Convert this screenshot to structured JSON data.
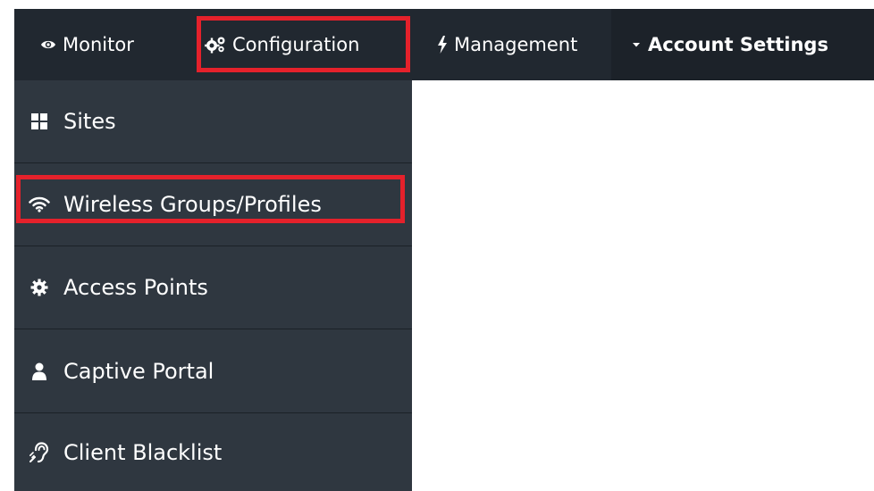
{
  "topnav": {
    "items": [
      {
        "label": "Monitor",
        "icon": "eye-icon"
      },
      {
        "label": "Configuration",
        "icon": "gears-icon"
      },
      {
        "label": "Management",
        "icon": "bolt-icon"
      },
      {
        "label": "Account Settings",
        "icon": "caret-down-icon"
      }
    ]
  },
  "sidebar": {
    "items": [
      {
        "label": "Sites",
        "icon": "grid-icon"
      },
      {
        "label": "Wireless Groups/Profiles",
        "icon": "wifi-icon"
      },
      {
        "label": "Access Points",
        "icon": "gear-icon"
      },
      {
        "label": "Captive Portal",
        "icon": "user-icon"
      },
      {
        "label": "Client Blacklist",
        "icon": "assistive-listening-icon"
      }
    ]
  },
  "colors": {
    "topbar_background": "#212830",
    "sidebar_background": "#2f3740",
    "highlight": "#e5212b",
    "text": "#ffffff"
  }
}
